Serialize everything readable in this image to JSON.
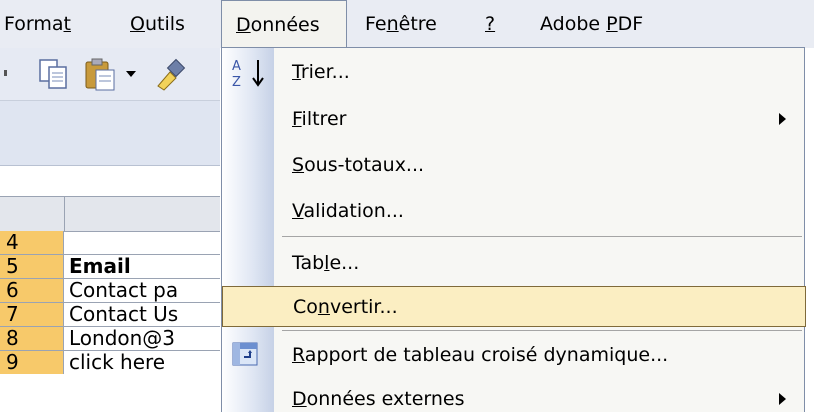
{
  "menubar": {
    "items": [
      {
        "label_pre": "Forma",
        "label_ul": "t",
        "label_post": ""
      },
      {
        "label_pre": "",
        "label_ul": "O",
        "label_post": "utils"
      },
      {
        "label_pre": "",
        "label_ul": "D",
        "label_post": "onnées"
      },
      {
        "label_pre": "Fe",
        "label_ul": "n",
        "label_post": "être"
      },
      {
        "label_pre": "",
        "label_ul": "?",
        "label_post": ""
      },
      {
        "label_pre": "Adobe ",
        "label_ul": "P",
        "label_post": "DF"
      }
    ]
  },
  "toolbar": {
    "icons": [
      "copy-icon",
      "paste-icon",
      "dropdown-arrow-icon",
      "format-painter-icon"
    ]
  },
  "sheet": {
    "rows": [
      {
        "num": "4",
        "value": ""
      },
      {
        "num": "5",
        "value": "Email"
      },
      {
        "num": "6",
        "value": "Contact pa"
      },
      {
        "num": "7",
        "value": "Contact Us"
      },
      {
        "num": "8",
        "value": "London@3"
      },
      {
        "num": "9",
        "value": "click here"
      }
    ]
  },
  "menu": {
    "items": [
      {
        "icon": "sort-ascending-icon",
        "pre": "",
        "ul": "T",
        "post": "rier...",
        "submenu": false
      },
      {
        "icon": "",
        "pre": "",
        "ul": "F",
        "post": "iltrer",
        "submenu": true
      },
      {
        "icon": "",
        "pre": "",
        "ul": "S",
        "post": "ous-totaux...",
        "submenu": false
      },
      {
        "icon": "",
        "pre": "",
        "ul": "V",
        "post": "alidation...",
        "submenu": false
      },
      {
        "icon": "",
        "pre": "Tab",
        "ul": "l",
        "post": "e...",
        "submenu": false
      },
      {
        "icon": "",
        "pre": "Co",
        "ul": "n",
        "post": "vertir...",
        "submenu": false,
        "highlighted": true
      },
      {
        "icon": "pivot-table-icon",
        "pre": "",
        "ul": "R",
        "post": "apport de tableau croisé dynamique...",
        "submenu": false
      },
      {
        "icon": "",
        "pre": "",
        "ul": "D",
        "post": "onnées externes",
        "submenu": true
      }
    ]
  },
  "colors": {
    "menubar_bg": "#e9ecf3",
    "menu_bg": "#f7f7f4",
    "highlight_bg": "#fbeec2",
    "row_header_bg": "#f7c96a"
  }
}
